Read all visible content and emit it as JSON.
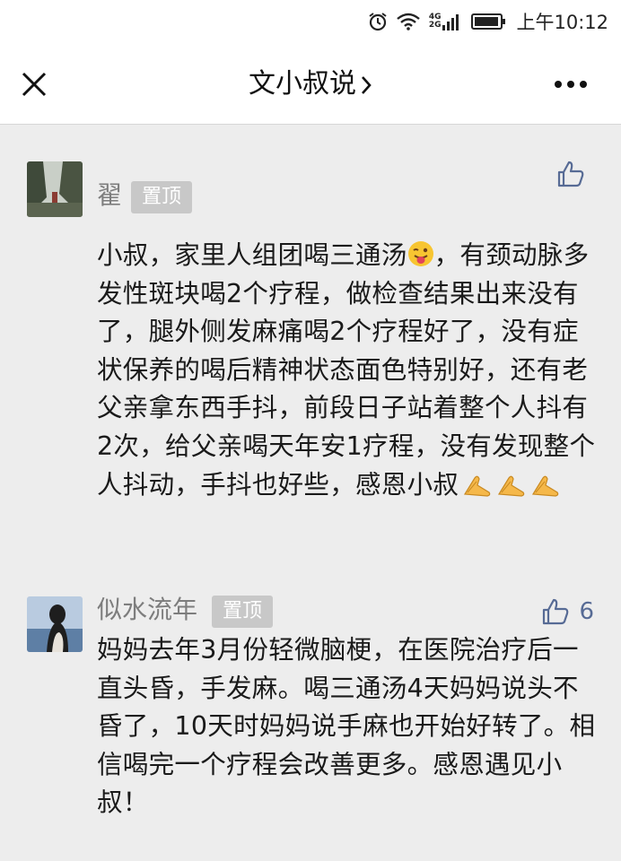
{
  "status_bar": {
    "network_label_top": "4G",
    "network_label_bottom": "2G",
    "time": "上午10:12"
  },
  "nav": {
    "title": "文小叔说"
  },
  "comments": [
    {
      "nickname": "翟",
      "badge": "置顶",
      "likes": "",
      "text": "小叔，家里人组团喝三通汤",
      "text_after_emoji": "，有颈动脉多发性斑块喝2个疗程，做检查结果出来没有了，腿外侧发麻痛喝2个疗程好了，没有症状保养的喝后精神状态面色特别好，还有老父亲拿东西手抖，前段日子站着整个人抖有2次，给父亲喝天年安1疗程，没有发现整个人抖动，手抖也好些，感恩小叔"
    },
    {
      "nickname": "似水流年",
      "badge": "置顶",
      "likes": "6",
      "text": "妈妈去年3月份轻微脑梗，在医院治疗后一直头昏，手发麻。喝三通汤4天妈妈说头不昏了，10天时妈妈说手麻也开始好转了。相信喝完一个疗程会改善更多。感恩遇见小叔！"
    }
  ],
  "colors": {
    "accent": "#576b95",
    "background": "#ededed",
    "badge": "#c8c8c8"
  },
  "icons": [
    "alarm-icon",
    "wifi-icon",
    "signal-icon",
    "battery-icon",
    "close-icon",
    "chevron-right-icon",
    "more-icon",
    "thumbs-up-icon",
    "winking-tongue-emoji",
    "praying-hands-emoji"
  ]
}
